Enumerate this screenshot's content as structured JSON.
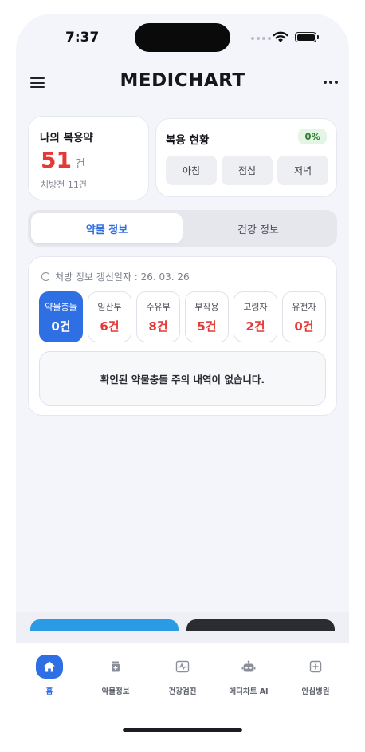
{
  "status_bar": {
    "time": "7:37"
  },
  "header": {
    "title": "MEDICHART"
  },
  "my_meds": {
    "title": "나의 복용약",
    "count": "51",
    "unit": "건",
    "sub": "처방전 11건"
  },
  "dose_status": {
    "title": "복용 현황",
    "percent": "0%",
    "times": [
      "아침",
      "점심",
      "저녁"
    ]
  },
  "tabs": [
    {
      "label": "약물 정보",
      "active": true
    },
    {
      "label": "건강 정보",
      "active": false
    }
  ],
  "info": {
    "update_label": "처방 정보 갱신일자 : 26. 03. 26",
    "chips": [
      {
        "label": "약물충돌",
        "value": "0건",
        "active": true
      },
      {
        "label": "임산부",
        "value": "6건"
      },
      {
        "label": "수유부",
        "value": "8건"
      },
      {
        "label": "부작용",
        "value": "5건"
      },
      {
        "label": "고령자",
        "value": "2건"
      },
      {
        "label": "유전자",
        "value": "0건"
      }
    ],
    "notice": "확인된 약물충돌 주의 내역이 없습니다."
  },
  "bottom_nav": [
    {
      "label": "홈",
      "icon": "home-icon",
      "active": true
    },
    {
      "label": "약물정보",
      "icon": "pill-bottle-icon"
    },
    {
      "label": "건강검진",
      "icon": "heartbeat-icon"
    },
    {
      "label": "메디차트 AI",
      "icon": "robot-icon"
    },
    {
      "label": "안심병원",
      "icon": "hospital-icon"
    }
  ],
  "colors": {
    "accent": "#2f6fe4",
    "alert": "#e53935",
    "success": "#2e7d32"
  }
}
